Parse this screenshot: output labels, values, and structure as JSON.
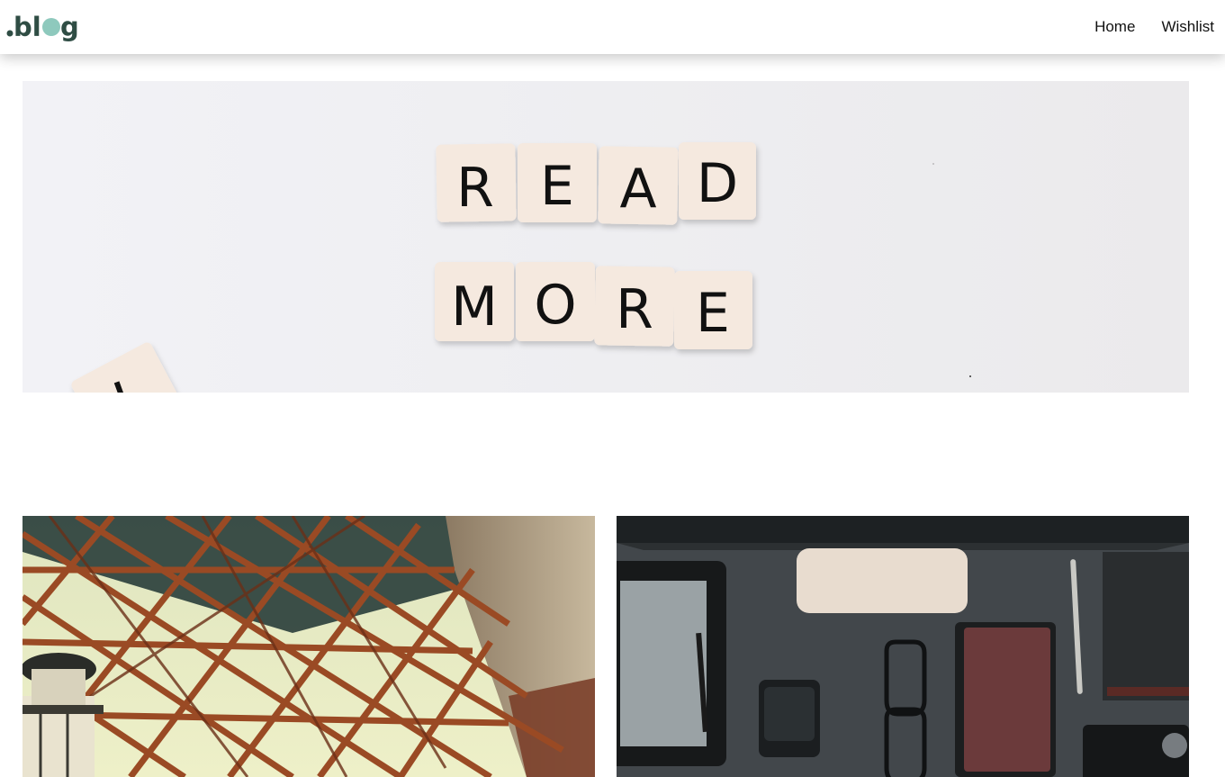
{
  "header": {
    "logo_text": ".blog",
    "nav": [
      {
        "label": "Home"
      },
      {
        "label": "Wishlist"
      }
    ]
  },
  "hero": {
    "tiles_row1": [
      "R",
      "E",
      "A",
      "D"
    ],
    "tiles_row2": [
      "M",
      "O",
      "R",
      "E"
    ],
    "background": "#eeeef0"
  },
  "posts": [
    {
      "image": "steel-bridge-structure-photo",
      "tone": "#8a4a26"
    },
    {
      "image": "desk-workspace-flatlay-photo",
      "tone": "#3f4549"
    }
  ],
  "colors": {
    "logo_dark": "#2f4d44",
    "logo_accent": "#8ec9bd",
    "nav_text": "#111111"
  }
}
